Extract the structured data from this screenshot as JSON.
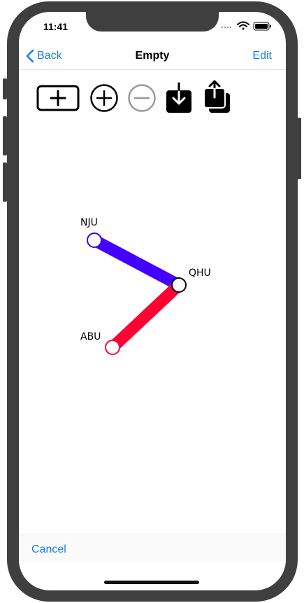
{
  "status_bar": {
    "time": "11:41"
  },
  "navbar": {
    "back_label": "Back",
    "title": "Empty",
    "edit_label": "Edit"
  },
  "toolbar": {
    "tools": [
      {
        "name": "add-box-icon"
      },
      {
        "name": "zoom-in-icon"
      },
      {
        "name": "zoom-out-icon"
      },
      {
        "name": "download-icon"
      },
      {
        "name": "share-icon"
      }
    ]
  },
  "graph": {
    "nodes": [
      {
        "id": "NJU",
        "label": "NJU",
        "stroke": "#3a00ff"
      },
      {
        "id": "QHU",
        "label": "QHU",
        "stroke": "#000000"
      },
      {
        "id": "ABU",
        "label": "ABU",
        "stroke": "#ff0033"
      }
    ],
    "edges": [
      {
        "from": "NJU",
        "to": "QHU",
        "color": "#4400ff"
      },
      {
        "from": "QHU",
        "to": "ABU",
        "color": "#ff0033"
      }
    ]
  },
  "bottom_bar": {
    "cancel_label": "Cancel"
  },
  "colors": {
    "accent": "#1a7cf5",
    "disabled": "#9a9a9a",
    "frame": "#3f3f3f"
  }
}
